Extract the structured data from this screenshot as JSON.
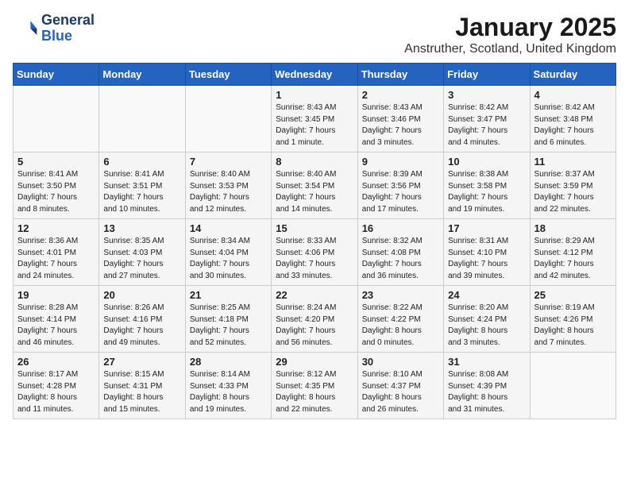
{
  "header": {
    "logo_line1": "General",
    "logo_line2": "Blue",
    "month": "January 2025",
    "location": "Anstruther, Scotland, United Kingdom"
  },
  "weekdays": [
    "Sunday",
    "Monday",
    "Tuesday",
    "Wednesday",
    "Thursday",
    "Friday",
    "Saturday"
  ],
  "weeks": [
    [
      {
        "day": "",
        "info": ""
      },
      {
        "day": "",
        "info": ""
      },
      {
        "day": "",
        "info": ""
      },
      {
        "day": "1",
        "info": "Sunrise: 8:43 AM\nSunset: 3:45 PM\nDaylight: 7 hours\nand 1 minute."
      },
      {
        "day": "2",
        "info": "Sunrise: 8:43 AM\nSunset: 3:46 PM\nDaylight: 7 hours\nand 3 minutes."
      },
      {
        "day": "3",
        "info": "Sunrise: 8:42 AM\nSunset: 3:47 PM\nDaylight: 7 hours\nand 4 minutes."
      },
      {
        "day": "4",
        "info": "Sunrise: 8:42 AM\nSunset: 3:48 PM\nDaylight: 7 hours\nand 6 minutes."
      }
    ],
    [
      {
        "day": "5",
        "info": "Sunrise: 8:41 AM\nSunset: 3:50 PM\nDaylight: 7 hours\nand 8 minutes."
      },
      {
        "day": "6",
        "info": "Sunrise: 8:41 AM\nSunset: 3:51 PM\nDaylight: 7 hours\nand 10 minutes."
      },
      {
        "day": "7",
        "info": "Sunrise: 8:40 AM\nSunset: 3:53 PM\nDaylight: 7 hours\nand 12 minutes."
      },
      {
        "day": "8",
        "info": "Sunrise: 8:40 AM\nSunset: 3:54 PM\nDaylight: 7 hours\nand 14 minutes."
      },
      {
        "day": "9",
        "info": "Sunrise: 8:39 AM\nSunset: 3:56 PM\nDaylight: 7 hours\nand 17 minutes."
      },
      {
        "day": "10",
        "info": "Sunrise: 8:38 AM\nSunset: 3:58 PM\nDaylight: 7 hours\nand 19 minutes."
      },
      {
        "day": "11",
        "info": "Sunrise: 8:37 AM\nSunset: 3:59 PM\nDaylight: 7 hours\nand 22 minutes."
      }
    ],
    [
      {
        "day": "12",
        "info": "Sunrise: 8:36 AM\nSunset: 4:01 PM\nDaylight: 7 hours\nand 24 minutes."
      },
      {
        "day": "13",
        "info": "Sunrise: 8:35 AM\nSunset: 4:03 PM\nDaylight: 7 hours\nand 27 minutes."
      },
      {
        "day": "14",
        "info": "Sunrise: 8:34 AM\nSunset: 4:04 PM\nDaylight: 7 hours\nand 30 minutes."
      },
      {
        "day": "15",
        "info": "Sunrise: 8:33 AM\nSunset: 4:06 PM\nDaylight: 7 hours\nand 33 minutes."
      },
      {
        "day": "16",
        "info": "Sunrise: 8:32 AM\nSunset: 4:08 PM\nDaylight: 7 hours\nand 36 minutes."
      },
      {
        "day": "17",
        "info": "Sunrise: 8:31 AM\nSunset: 4:10 PM\nDaylight: 7 hours\nand 39 minutes."
      },
      {
        "day": "18",
        "info": "Sunrise: 8:29 AM\nSunset: 4:12 PM\nDaylight: 7 hours\nand 42 minutes."
      }
    ],
    [
      {
        "day": "19",
        "info": "Sunrise: 8:28 AM\nSunset: 4:14 PM\nDaylight: 7 hours\nand 46 minutes."
      },
      {
        "day": "20",
        "info": "Sunrise: 8:26 AM\nSunset: 4:16 PM\nDaylight: 7 hours\nand 49 minutes."
      },
      {
        "day": "21",
        "info": "Sunrise: 8:25 AM\nSunset: 4:18 PM\nDaylight: 7 hours\nand 52 minutes."
      },
      {
        "day": "22",
        "info": "Sunrise: 8:24 AM\nSunset: 4:20 PM\nDaylight: 7 hours\nand 56 minutes."
      },
      {
        "day": "23",
        "info": "Sunrise: 8:22 AM\nSunset: 4:22 PM\nDaylight: 8 hours\nand 0 minutes."
      },
      {
        "day": "24",
        "info": "Sunrise: 8:20 AM\nSunset: 4:24 PM\nDaylight: 8 hours\nand 3 minutes."
      },
      {
        "day": "25",
        "info": "Sunrise: 8:19 AM\nSunset: 4:26 PM\nDaylight: 8 hours\nand 7 minutes."
      }
    ],
    [
      {
        "day": "26",
        "info": "Sunrise: 8:17 AM\nSunset: 4:28 PM\nDaylight: 8 hours\nand 11 minutes."
      },
      {
        "day": "27",
        "info": "Sunrise: 8:15 AM\nSunset: 4:31 PM\nDaylight: 8 hours\nand 15 minutes."
      },
      {
        "day": "28",
        "info": "Sunrise: 8:14 AM\nSunset: 4:33 PM\nDaylight: 8 hours\nand 19 minutes."
      },
      {
        "day": "29",
        "info": "Sunrise: 8:12 AM\nSunset: 4:35 PM\nDaylight: 8 hours\nand 22 minutes."
      },
      {
        "day": "30",
        "info": "Sunrise: 8:10 AM\nSunset: 4:37 PM\nDaylight: 8 hours\nand 26 minutes."
      },
      {
        "day": "31",
        "info": "Sunrise: 8:08 AM\nSunset: 4:39 PM\nDaylight: 8 hours\nand 31 minutes."
      },
      {
        "day": "",
        "info": ""
      }
    ]
  ]
}
